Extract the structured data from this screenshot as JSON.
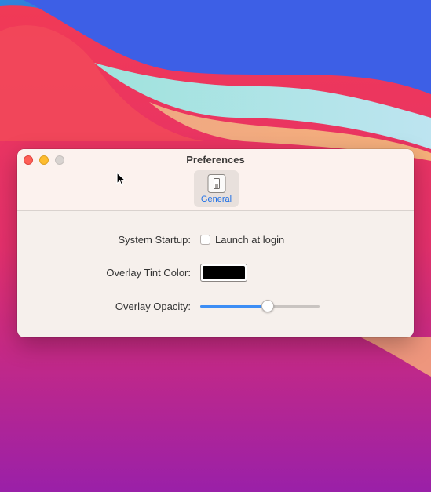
{
  "window": {
    "title": "Preferences"
  },
  "toolbar": {
    "tabs": [
      {
        "label": "General",
        "icon": "switch-icon",
        "selected": true
      }
    ]
  },
  "settings": {
    "startup_label": "System Startup:",
    "launch_label": "Launch at login",
    "launch_checked": false,
    "tint_label": "Overlay Tint Color:",
    "tint_color": "#000000",
    "opacity_label": "Overlay Opacity:",
    "opacity_value": 0.57
  },
  "colors": {
    "accent": "#1f6fe6",
    "slider_fill": "#3d8ef5"
  }
}
